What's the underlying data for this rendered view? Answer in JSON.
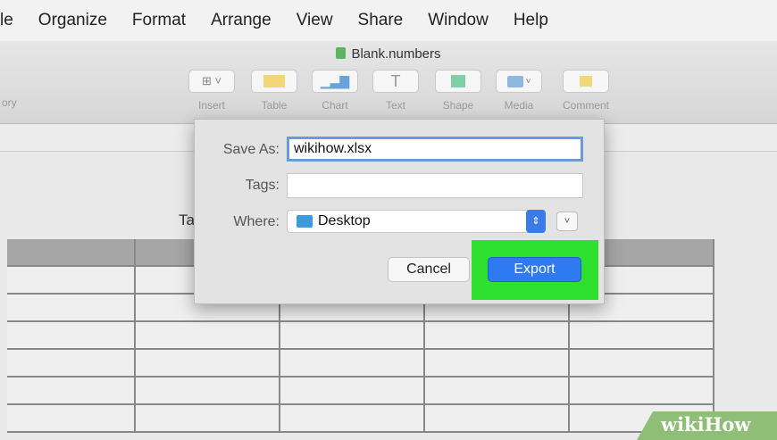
{
  "menubar": {
    "items": [
      "le",
      "Organize",
      "Format",
      "Arrange",
      "View",
      "Share",
      "Window",
      "Help"
    ]
  },
  "window": {
    "title": "Blank.numbers"
  },
  "toolbar": {
    "left_label": "ory",
    "buttons": [
      {
        "label": "Insert"
      },
      {
        "label": "Table"
      },
      {
        "label": "Chart"
      },
      {
        "label": "Text"
      },
      {
        "label": "Shape"
      },
      {
        "label": "Media"
      },
      {
        "label": "Comment"
      }
    ]
  },
  "sheet": {
    "table_title_partial": "Ta"
  },
  "dialog": {
    "save_as_label": "Save As:",
    "save_as_value": "wikihow.xlsx",
    "tags_label": "Tags:",
    "tags_value": "",
    "where_label": "Where:",
    "where_value": "Desktop",
    "cancel_label": "Cancel",
    "export_label": "Export"
  },
  "watermark": {
    "text": "wikiHow"
  },
  "colors": {
    "export_button": "#2f7af0",
    "highlight": "#2fe02f",
    "stepper": "#3a7bea"
  }
}
